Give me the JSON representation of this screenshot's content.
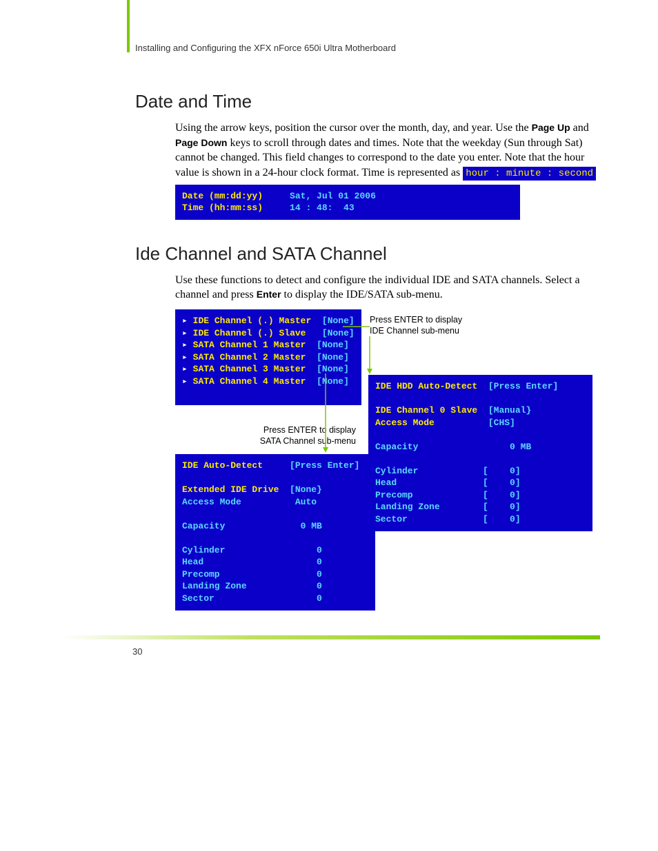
{
  "header": "Installing and Configuring the XFX nForce 650i Ultra Motherboard",
  "section1": {
    "title": "Date and Time",
    "para_pre": "Using the arrow keys, position the cursor over the month, day, and year. Use the ",
    "pu": "Page Up",
    "mid1": " and ",
    "pd": "Page Down",
    "mid2": " keys to scroll through dates and times. Note that the weekday (Sun through Sat) cannot be changed. This field changes to correspond to the date you enter. Note that the hour value is shown in a 24-hour clock format. Time is represented as ",
    "hl": "hour : minute : second",
    "bios": {
      "l1a": "Date (mm:dd:yy)",
      "l1b": "Sat, Jul 01 2006",
      "l2a": "Time (hh:mm:ss)",
      "l2b": "14 : 48:  43"
    }
  },
  "section2": {
    "title": "Ide Channel and SATA Channel",
    "para_pre": "Use these functions to detect and configure the individual IDE and SATA channels. Select a channel and press ",
    "enter": "Enter",
    "para_post": " to display the IDE/SATA sub-menu."
  },
  "channels": [
    {
      "label": "IDE Channel (.) Master",
      "val": "[None]"
    },
    {
      "label": "IDE Channel (.) Slave",
      "val": "[None]"
    },
    {
      "label": "SATA Channel 1 Master",
      "val": "[None]"
    },
    {
      "label": "SATA Channel 2 Master",
      "val": "[None]"
    },
    {
      "label": "SATA Channel 3 Master",
      "val": "[None]"
    },
    {
      "label": "SATA Channel 4 Master",
      "val": "[None]"
    }
  ],
  "note1a": "Press ENTER to display",
  "note1b": "IDE Channel sub-menu",
  "note2a": "Press ENTER to display",
  "note2b": "SATA Channel sub-menu",
  "sata_sub": {
    "r1a": "IDE Auto-Detect",
    "r1b": "[Press Enter]",
    "r2a": "Extended IDE Drive",
    "r2b": "[None}",
    "r3a": "Access Mode",
    "r3b": " Auto",
    "r4a": "Capacity",
    "r4b": "0 MB",
    "r5a": "Cylinder",
    "r5b": "0",
    "r6a": "Head",
    "r6b": "0",
    "r7a": "Precomp",
    "r7b": "0",
    "r8a": "Landing Zone",
    "r8b": "0",
    "r9a": "Sector",
    "r9b": "0"
  },
  "ide_sub": {
    "r1a": "IDE HDD Auto-Detect",
    "r1b": "[Press Enter]",
    "r2a": "IDE Channel 0 Slave",
    "r2b": "[Manual}",
    "r3a": "Access Mode",
    "r3b": "[CHS]",
    "r4a": "Capacity",
    "r4b": "0 MB",
    "r5a": "Cylinder",
    "r5b": "[    0]",
    "r6a": "Head",
    "r6b": "[    0]",
    "r7a": "Precomp",
    "r7b": "[    0]",
    "r8a": "Landing Zone",
    "r8b": "[    0]",
    "r9a": "Sector",
    "r9b": "[    0]"
  },
  "page_num": "30"
}
